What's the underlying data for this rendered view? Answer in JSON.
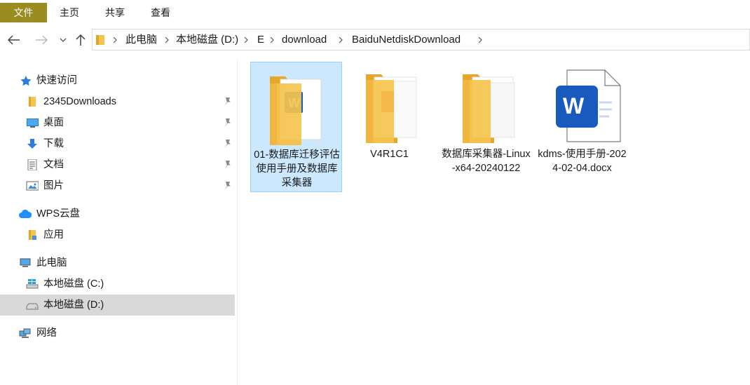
{
  "ribbon": {
    "tabs": [
      "文件",
      "主页",
      "共享",
      "查看"
    ]
  },
  "address": {
    "crumbs": [
      "此电脑",
      "本地磁盘 (D:)",
      "E",
      "download",
      "BaiduNetdiskDownload"
    ]
  },
  "sidebar": {
    "quick_access": "快速访问",
    "quick_items": [
      "2345Downloads",
      "桌面",
      "下载",
      "文档",
      "图片"
    ],
    "wps": "WPS云盘",
    "wps_items": [
      "应用"
    ],
    "this_pc": "此电脑",
    "pc_items": [
      "本地磁盘 (C:)",
      "本地磁盘 (D:)"
    ],
    "network": "网络"
  },
  "files": [
    {
      "name": "01-数据库迁移评估使用手册及数据库采集器",
      "type": "folder-word"
    },
    {
      "name": "V4R1C1",
      "type": "folder-pdf"
    },
    {
      "name": "数据库采集器-Linux-x64-20240122",
      "type": "folder-blank"
    },
    {
      "name": "kdms-使用手册-2024-02-04.docx",
      "type": "word-doc"
    }
  ],
  "colors": {
    "file_tab": "#9b8c21",
    "folder": "#f5c44e",
    "word_blue": "#185abd",
    "selection": "#cce8ff",
    "selected_nav": "#d9d9d9"
  }
}
